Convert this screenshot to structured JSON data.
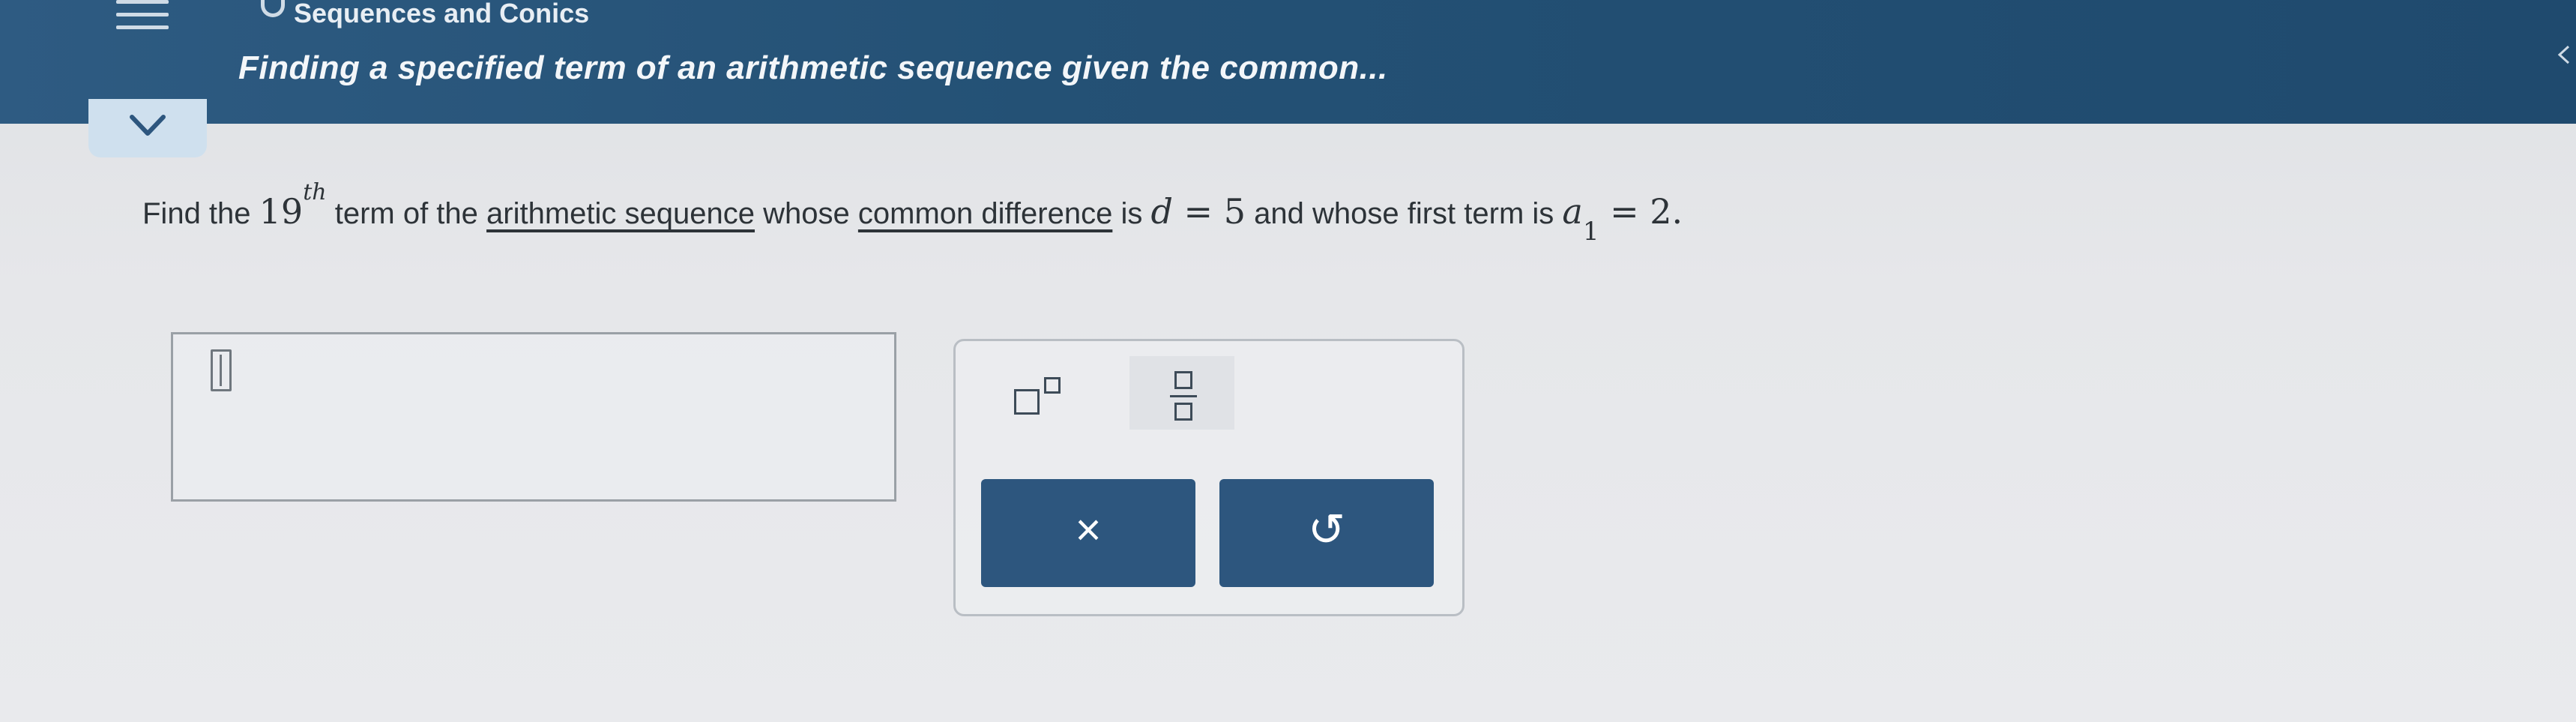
{
  "header": {
    "topic": "Sequences and Conics",
    "subtopic": "Finding a specified term of an arithmetic sequence given the common..."
  },
  "question": {
    "find_the": "Find the",
    "term_number": "19",
    "term_suffix": "th",
    "text_term_of_the": "term of the",
    "link_arithmetic_sequence": "arithmetic sequence",
    "text_whose": "whose",
    "link_common_difference": "common difference",
    "text_is": "is",
    "d_var": "d",
    "d_eq": "=",
    "d_value": "5",
    "text_and_first": "and whose first term is",
    "a_var": "a",
    "a_sub": "1",
    "a_eq": "=",
    "a_value": "2",
    "period": "."
  },
  "keypad": {
    "clear_symbol": "×",
    "undo_symbol": "↺"
  },
  "icons": {
    "menu": "hamburger-menu-icon",
    "collapse": "chevron-down-icon",
    "superscript": "superscript-template-icon",
    "fraction": "fraction-template-icon"
  },
  "colors": {
    "header_bg": "#245175",
    "button_bg": "#2d567e",
    "text": "#2d3338"
  }
}
